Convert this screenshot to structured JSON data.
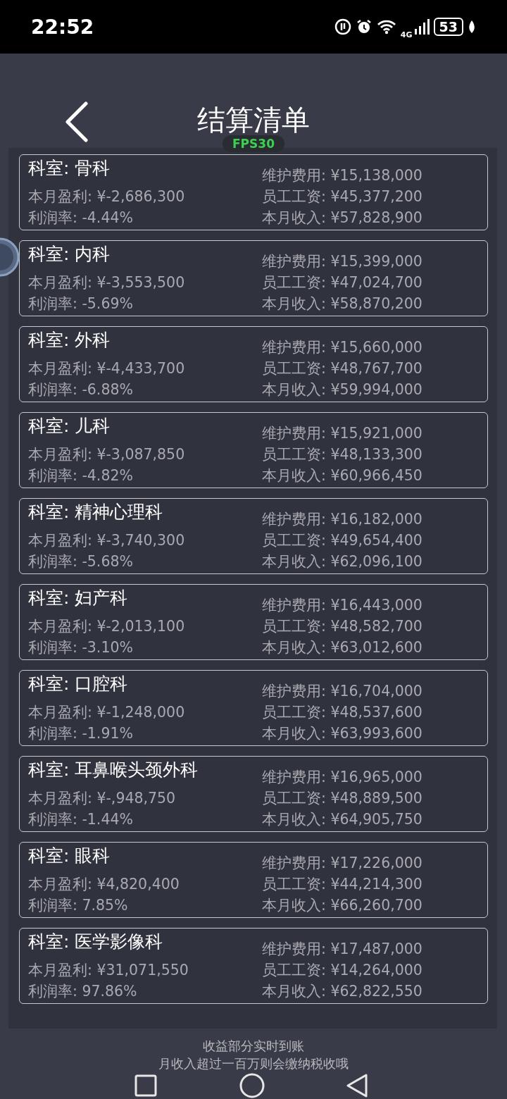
{
  "status_bar": {
    "time": "22:52",
    "network_type": "4G",
    "battery": "53"
  },
  "header": {
    "title": "结算清单",
    "fps_badge": "FPS30"
  },
  "departments": [
    {
      "title": "科室: 骨科",
      "profit": "本月盈利: ¥-2,686,300",
      "margin": "利润率: -4.44%",
      "maintenance": "维护费用: ¥15,138,000",
      "salary": "员工工资: ¥45,377,200",
      "income": "本月收入: ¥57,828,900"
    },
    {
      "title": "科室: 内科",
      "profit": "本月盈利: ¥-3,553,500",
      "margin": "利润率: -5.69%",
      "maintenance": "维护费用: ¥15,399,000",
      "salary": "员工工资: ¥47,024,700",
      "income": "本月收入: ¥58,870,200"
    },
    {
      "title": "科室: 外科",
      "profit": "本月盈利: ¥-4,433,700",
      "margin": "利润率: -6.88%",
      "maintenance": "维护费用: ¥15,660,000",
      "salary": "员工工资: ¥48,767,700",
      "income": "本月收入: ¥59,994,000"
    },
    {
      "title": "科室: 儿科",
      "profit": "本月盈利: ¥-3,087,850",
      "margin": "利润率: -4.82%",
      "maintenance": "维护费用: ¥15,921,000",
      "salary": "员工工资: ¥48,133,300",
      "income": "本月收入: ¥60,966,450"
    },
    {
      "title": "科室: 精神心理科",
      "profit": "本月盈利: ¥-3,740,300",
      "margin": "利润率: -5.68%",
      "maintenance": "维护费用: ¥16,182,000",
      "salary": "员工工资: ¥49,654,400",
      "income": "本月收入: ¥62,096,100"
    },
    {
      "title": "科室: 妇产科",
      "profit": "本月盈利: ¥-2,013,100",
      "margin": "利润率: -3.10%",
      "maintenance": "维护费用: ¥16,443,000",
      "salary": "员工工资: ¥48,582,700",
      "income": "本月收入: ¥63,012,600"
    },
    {
      "title": "科室: 口腔科",
      "profit": "本月盈利: ¥-1,248,000",
      "margin": "利润率: -1.91%",
      "maintenance": "维护费用: ¥16,704,000",
      "salary": "员工工资: ¥48,537,600",
      "income": "本月收入: ¥63,993,600"
    },
    {
      "title": "科室: 耳鼻喉头颈外科",
      "profit": "本月盈利: ¥-,948,750",
      "margin": "利润率: -1.44%",
      "maintenance": "维护费用: ¥16,965,000",
      "salary": "员工工资: ¥48,889,500",
      "income": "本月收入: ¥64,905,750"
    },
    {
      "title": "科室: 眼科",
      "profit": "本月盈利: ¥4,820,400",
      "margin": "利润率: 7.85%",
      "maintenance": "维护费用: ¥17,226,000",
      "salary": "员工工资: ¥44,214,300",
      "income": "本月收入: ¥66,260,700"
    },
    {
      "title": "科室: 医学影像科",
      "profit": "本月盈利: ¥31,071,550",
      "margin": "利润率: 97.86%",
      "maintenance": "维护费用: ¥17,487,000",
      "salary": "员工工资: ¥14,264,000",
      "income": "本月收入: ¥62,822,550"
    }
  ],
  "footer": {
    "notes": [
      "收益部分实时到账",
      "月收入超过一百万则会缴纳税收哦"
    ]
  }
}
